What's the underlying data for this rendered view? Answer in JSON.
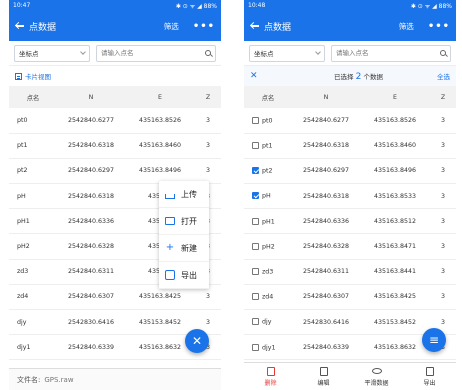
{
  "left": {
    "status_time": "10:47",
    "status_right": "✱ ⊙ ᯤ ◢ 88%",
    "title": "点数据",
    "filter_label": "筛选",
    "more_label": "•••",
    "filter_select": "坐标点",
    "search_placeholder": "请输入点名",
    "card_view_label": "卡片视图",
    "columns": [
      "点名",
      "N",
      "E",
      "Z"
    ],
    "rows": [
      {
        "name": "pt0",
        "n": "2542840.6277",
        "e": "435163.8526",
        "z": "3"
      },
      {
        "name": "pt1",
        "n": "2542840.6318",
        "e": "435163.8460",
        "z": "3"
      },
      {
        "name": "pt2",
        "n": "2542840.6297",
        "e": "435163.8496",
        "z": "3"
      },
      {
        "name": "pH",
        "n": "2542840.6318",
        "e": "435163",
        "z": "3"
      },
      {
        "name": "pH1",
        "n": "2542840.6336",
        "e": "435163",
        "z": "3"
      },
      {
        "name": "pH2",
        "n": "2542840.6328",
        "e": "435163",
        "z": "3"
      },
      {
        "name": "zd3",
        "n": "2542840.6311",
        "e": "435163",
        "z": "3"
      },
      {
        "name": "zd4",
        "n": "2542840.6307",
        "e": "435163.8425",
        "z": "3"
      },
      {
        "name": "djy",
        "n": "2542830.6416",
        "e": "435153.8452",
        "z": "3"
      },
      {
        "name": "djy1",
        "n": "2542840.6339",
        "e": "435163.8632",
        "z": "3"
      }
    ],
    "menu": [
      {
        "icon": "upload-icon",
        "label": "上传"
      },
      {
        "icon": "folder-open-icon",
        "label": "打开"
      },
      {
        "icon": "plus-icon",
        "label": "新建"
      },
      {
        "icon": "export-icon",
        "label": "导出"
      }
    ],
    "fab_symbol": "✕",
    "file_label": "文件名:",
    "file_value": "GPS.raw"
  },
  "right": {
    "status_time": "10:48",
    "status_right": "✱ ⊙ ᯤ ◢ 88%",
    "title": "点数据",
    "filter_label": "筛选",
    "more_label": "•••",
    "filter_select": "坐标点",
    "search_placeholder": "请输入点名",
    "close_symbol": "✕",
    "selected_prefix": "已选择",
    "selected_count": "2",
    "selected_suffix": "个数据",
    "select_all_label": "全选",
    "columns": [
      "点名",
      "N",
      "E",
      "Z"
    ],
    "rows": [
      {
        "name": "pt0",
        "n": "2542840.6277",
        "e": "435163.8526",
        "z": "3",
        "checked": false
      },
      {
        "name": "pt1",
        "n": "2542840.6318",
        "e": "435163.8460",
        "z": "3",
        "checked": false
      },
      {
        "name": "pt2",
        "n": "2542840.6297",
        "e": "435163.8496",
        "z": "3",
        "checked": true
      },
      {
        "name": "pH",
        "n": "2542840.6318",
        "e": "435163.8533",
        "z": "3",
        "checked": true
      },
      {
        "name": "pH1",
        "n": "2542840.6336",
        "e": "435163.8512",
        "z": "3",
        "checked": false
      },
      {
        "name": "pH2",
        "n": "2542840.6328",
        "e": "435163.8471",
        "z": "3",
        "checked": false
      },
      {
        "name": "zd3",
        "n": "2542840.6311",
        "e": "435163.8441",
        "z": "3",
        "checked": false
      },
      {
        "name": "zd4",
        "n": "2542840.6307",
        "e": "435163.8425",
        "z": "3",
        "checked": false
      },
      {
        "name": "djy",
        "n": "2542830.6416",
        "e": "435153.8452",
        "z": "3",
        "checked": false
      },
      {
        "name": "djy1",
        "n": "2542840.6339",
        "e": "435163.8632",
        "z": "3",
        "checked": false
      }
    ],
    "fab_symbol": "≡",
    "nav": [
      {
        "icon": "delete-icon",
        "label": "删除"
      },
      {
        "icon": "edit-icon",
        "label": "编辑"
      },
      {
        "icon": "eye-icon",
        "label": "平滑数据"
      },
      {
        "icon": "export-icon",
        "label": "导出"
      }
    ]
  },
  "colors": {
    "primary": "#1a73e8",
    "danger": "#e53935"
  }
}
